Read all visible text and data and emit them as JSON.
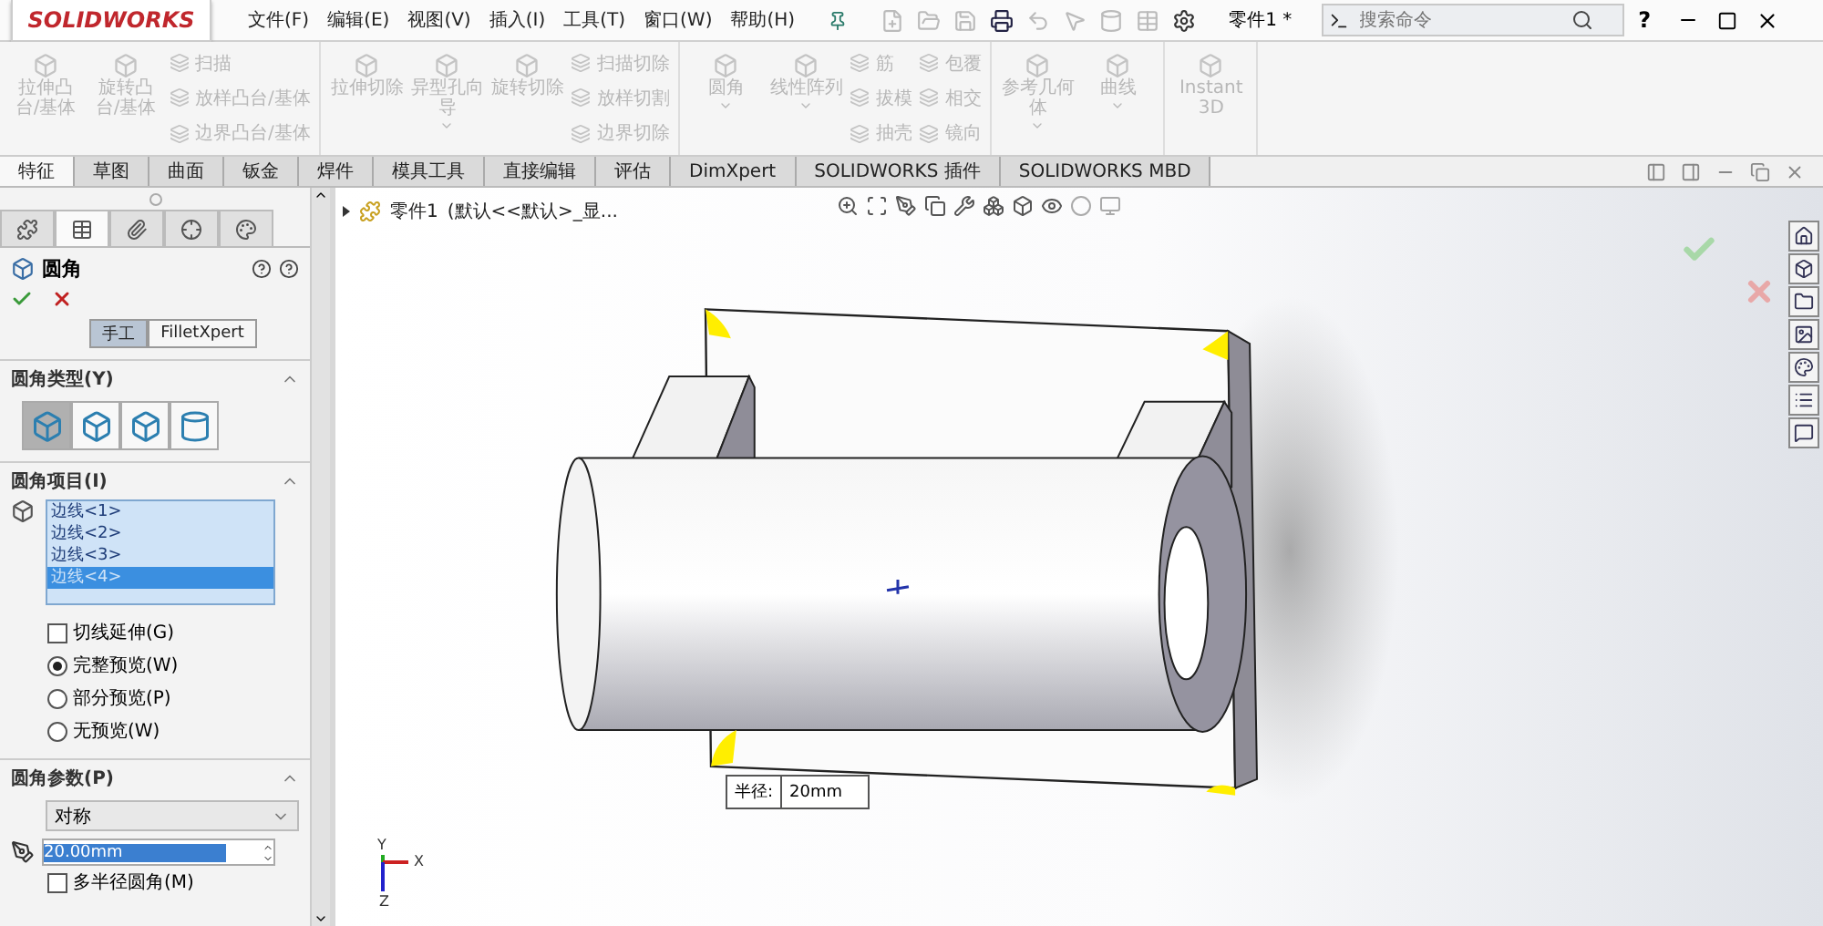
{
  "title_bar": {
    "logo": "SOLIDWORKS",
    "menu": [
      "文件(F)",
      "编辑(E)",
      "视图(V)",
      "插入(I)",
      "工具(T)",
      "窗口(W)",
      "帮助(H)"
    ],
    "document": "零件1 *",
    "search": {
      "placeholder": "搜索命令"
    },
    "help": "?"
  },
  "ribbon": {
    "groups": [
      {
        "columns": [
          {
            "kind": "large",
            "label": "拉伸凸台/基体",
            "disabled": true
          },
          {
            "kind": "large",
            "label": "旋转凸台/基体",
            "disabled": true
          },
          {
            "kind": "stack",
            "items": [
              {
                "label": "扫描",
                "disabled": true
              },
              {
                "label": "放样凸台/基体",
                "disabled": true
              },
              {
                "label": "边界凸台/基体",
                "disabled": true
              }
            ]
          }
        ]
      },
      {
        "columns": [
          {
            "kind": "large",
            "label": "拉伸切除",
            "disabled": true
          },
          {
            "kind": "large",
            "label": "异型孔向导",
            "disabled": true,
            "dropdown": true
          },
          {
            "kind": "large",
            "label": "旋转切除",
            "disabled": true
          },
          {
            "kind": "stack",
            "items": [
              {
                "label": "扫描切除",
                "disabled": true
              },
              {
                "label": "放样切割",
                "disabled": true
              },
              {
                "label": "边界切除",
                "disabled": true
              }
            ]
          }
        ]
      },
      {
        "columns": [
          {
            "kind": "large",
            "label": "圆角",
            "disabled": true,
            "dropdown": true
          },
          {
            "kind": "large",
            "label": "线性阵列",
            "disabled": true,
            "dropdown": true
          },
          {
            "kind": "stack",
            "items": [
              {
                "label": "筋",
                "disabled": true
              },
              {
                "label": "拔模",
                "disabled": true
              },
              {
                "label": "抽壳",
                "disabled": true
              }
            ]
          },
          {
            "kind": "stack",
            "items": [
              {
                "label": "包覆",
                "disabled": true
              },
              {
                "label": "相交",
                "disabled": true
              },
              {
                "label": "镜向",
                "disabled": true
              }
            ]
          }
        ]
      },
      {
        "columns": [
          {
            "kind": "large",
            "label": "参考几何体",
            "disabled": true,
            "dropdown": true
          },
          {
            "kind": "large",
            "label": "曲线",
            "disabled": true,
            "dropdown": true
          }
        ]
      },
      {
        "columns": [
          {
            "kind": "large",
            "label": "Instant3D",
            "disabled": true
          }
        ]
      }
    ]
  },
  "tabs": [
    {
      "label": "特征",
      "selected": true
    },
    {
      "label": "草图",
      "selected": false
    },
    {
      "label": "曲面",
      "selected": false
    },
    {
      "label": "钣金",
      "selected": false
    },
    {
      "label": "焊件",
      "selected": false
    },
    {
      "label": "模具工具",
      "selected": false
    },
    {
      "label": "直接编辑",
      "selected": false
    },
    {
      "label": "评估",
      "selected": false
    },
    {
      "label": "DimXpert",
      "selected": false
    },
    {
      "label": "SOLIDWORKS 插件",
      "selected": false
    },
    {
      "label": "SOLIDWORKS MBD",
      "selected": false
    }
  ],
  "property_panel": {
    "tabs": [
      {
        "selected": false
      },
      {
        "selected": true
      },
      {
        "selected": false
      },
      {
        "selected": false
      },
      {
        "selected": false
      }
    ],
    "title": "圆角",
    "mode": [
      {
        "label": "手工",
        "selected": true
      },
      {
        "label": "FilletXpert",
        "selected": false
      }
    ],
    "fillet_type": {
      "title": "圆角类型(Y)",
      "options": [
        {
          "selected": true
        },
        {
          "selected": false
        },
        {
          "selected": false
        },
        {
          "selected": false
        }
      ]
    },
    "fillet_items": {
      "title": "圆角项目(I)",
      "edges": [
        {
          "label": "边线<1>",
          "selected": false
        },
        {
          "label": "边线<2>",
          "selected": false
        },
        {
          "label": "边线<3>",
          "selected": false
        },
        {
          "label": "边线<4>",
          "selected": true
        }
      ],
      "options": [
        {
          "kind": "checkbox",
          "label": "切线延伸(G)",
          "checked": false
        },
        {
          "kind": "radio",
          "label": "完整预览(W)",
          "selected": true
        },
        {
          "kind": "radio",
          "label": "部分预览(P)",
          "selected": false
        },
        {
          "kind": "radio",
          "label": "无预览(W)",
          "selected": false
        }
      ]
    },
    "parameters": {
      "title": "圆角参数(P)",
      "method": "对称",
      "radius": "20.00mm",
      "multi_radius": {
        "label": "多半径圆角(M)",
        "checked": false
      }
    }
  },
  "viewport": {
    "tree_node": "零件1",
    "tree_config": "(默认<<默认>_显...",
    "tooltip": {
      "label": "半径:",
      "value": "20mm"
    },
    "axes": [
      "Y",
      "X",
      "Z"
    ]
  }
}
